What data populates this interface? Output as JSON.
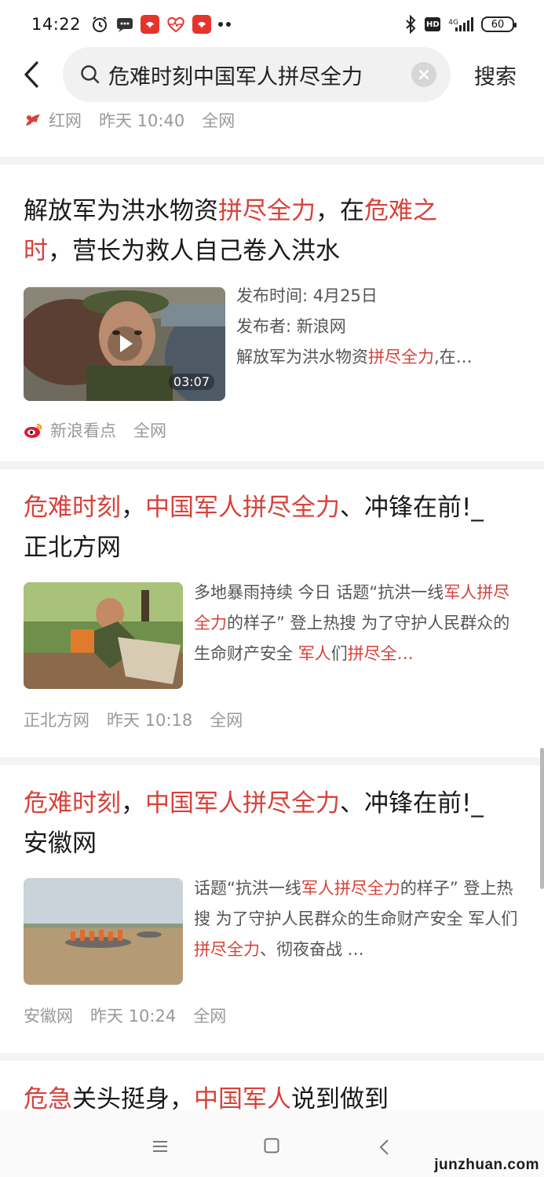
{
  "status_bar": {
    "time": "14:22",
    "network": "4G",
    "battery": "60"
  },
  "search": {
    "query": "危难时刻中国军人拼尽全力",
    "submit_label": "搜索"
  },
  "results": [
    {
      "source": "红网",
      "time": "昨天 10:40",
      "scope": "全网"
    },
    {
      "title_parts": [
        "解放军为洪水物资",
        "拼尽全力",
        "，在",
        "危难之",
        "时",
        "，营长为救人自己卷入洪水"
      ],
      "publish_time_label": "发布时间: 4月25日",
      "publisher_label": "发布者: 新浪网",
      "snippet_parts": [
        "解放军为洪水物资",
        "拼尽全力",
        ",在…"
      ],
      "duration": "03:07",
      "source": "新浪看点",
      "scope": "全网"
    },
    {
      "title_parts": [
        "危难时刻",
        "，",
        "中国军人拼尽全力",
        "、冲锋在前!_",
        "正北方网"
      ],
      "snippet_parts": [
        "多地暴雨持续 今日 话题“抗洪一线",
        "军人",
        "拼尽全力",
        "的样子” 登上热搜 为了守护人民群众的生命财产安全 ",
        "军人",
        "们",
        "拼尽全…"
      ],
      "source": "正北方网",
      "time": "昨天 10:18",
      "scope": "全网"
    },
    {
      "title_parts": [
        "危难时刻",
        "，",
        "中国军人拼尽全力",
        "、冲锋在前!_",
        "安徽网"
      ],
      "snippet_parts": [
        "话题“抗洪一线",
        "军人拼尽全力",
        "的样子” 登上热搜 为了守护人民群众的生命财产安全 军人们",
        "拼尽全力",
        "、彻夜奋战 …"
      ],
      "source": "安徽网",
      "time": "昨天 10:24",
      "scope": "全网"
    },
    {
      "title_parts": [
        "危急",
        "关头挺身，",
        "中国军人",
        "说到做到"
      ]
    }
  ],
  "watermark": "junzhuan.com",
  "colors": {
    "highlight": "#d8413a",
    "meta": "#999999"
  }
}
